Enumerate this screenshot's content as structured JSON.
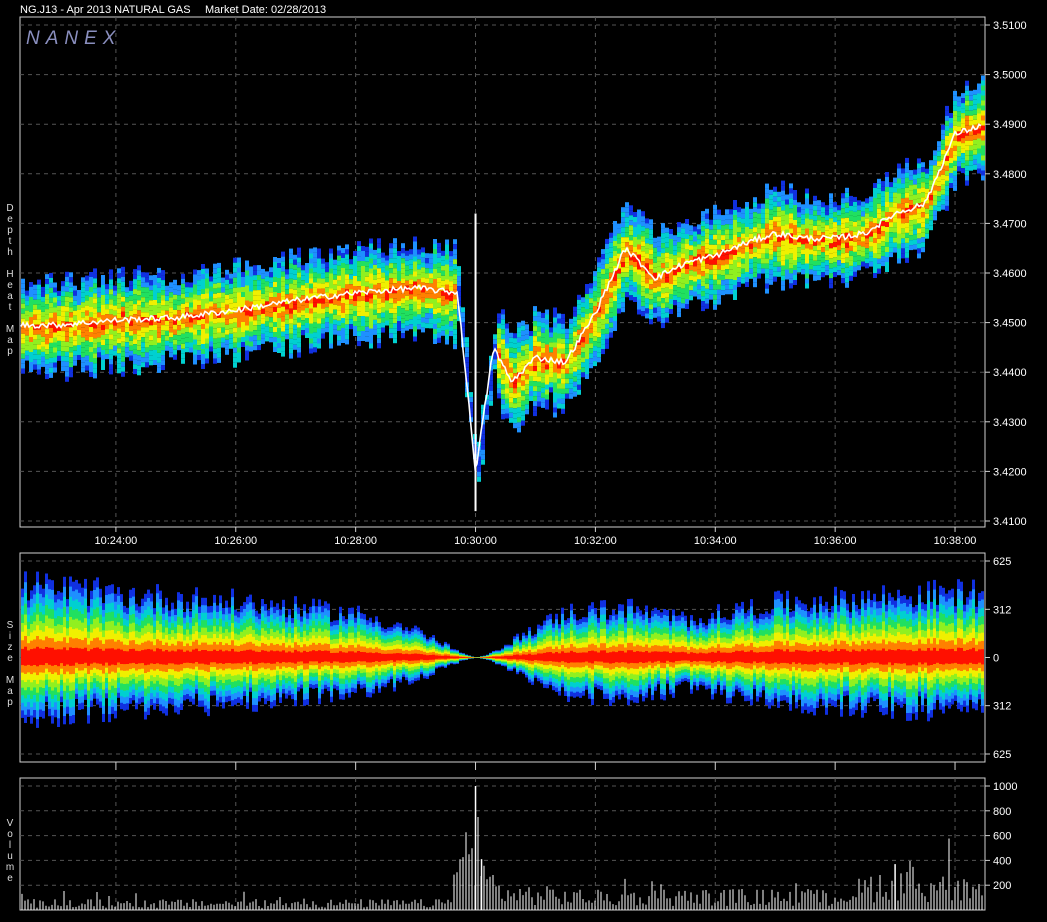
{
  "header": {
    "symbol": "NG.J13 - Apr 2013 NATURAL GAS",
    "market_date": "Market Date: 02/28/2013",
    "logo": "NANEX"
  },
  "panels": {
    "depth": {
      "label": "Depth Heat Map"
    },
    "size": {
      "label": "Size Map"
    },
    "volume": {
      "label": "Volume"
    }
  },
  "colors": {
    "background": "#000000",
    "frame": "#d0d0d0",
    "grid": "#555555",
    "heat_scale": [
      "#1030e0",
      "#1e90ff",
      "#00d0d0",
      "#20e060",
      "#90f020",
      "#f0f000",
      "#ff8000",
      "#ff1000"
    ],
    "last_trade": "#ffffff"
  },
  "chart_data": [
    {
      "type": "heatmap",
      "title": "Depth Heat Map",
      "x_ticks": [
        "10:24:00",
        "10:26:00",
        "10:28:00",
        "10:30:00",
        "10:32:00",
        "10:34:00",
        "10:36:00",
        "10:38:00"
      ],
      "y_ticks": [
        "3.4100",
        "3.4200",
        "3.4300",
        "3.4400",
        "3.4500",
        "3.4600",
        "3.4700",
        "3.4800",
        "3.4900",
        "3.5000",
        "3.5100"
      ],
      "ylim": [
        3.41,
        3.51
      ],
      "xlim_minutes": [
        22.4,
        38.5
      ],
      "price_path": [
        {
          "t": 22.4,
          "p": 3.4495
        },
        {
          "t": 23.0,
          "p": 3.4495
        },
        {
          "t": 24.0,
          "p": 3.4505
        },
        {
          "t": 25.0,
          "p": 3.451
        },
        {
          "t": 26.0,
          "p": 3.4525
        },
        {
          "t": 27.0,
          "p": 3.4545
        },
        {
          "t": 28.0,
          "p": 3.456
        },
        {
          "t": 29.0,
          "p": 3.457
        },
        {
          "t": 29.7,
          "p": 3.456
        },
        {
          "t": 30.0,
          "p": 3.42
        },
        {
          "t": 30.3,
          "p": 3.445
        },
        {
          "t": 30.6,
          "p": 3.438
        },
        {
          "t": 31.0,
          "p": 3.443
        },
        {
          "t": 31.5,
          "p": 3.442
        },
        {
          "t": 32.0,
          "p": 3.452
        },
        {
          "t": 32.5,
          "p": 3.465
        },
        {
          "t": 33.0,
          "p": 3.459
        },
        {
          "t": 33.5,
          "p": 3.462
        },
        {
          "t": 34.0,
          "p": 3.4635
        },
        {
          "t": 34.5,
          "p": 3.466
        },
        {
          "t": 35.0,
          "p": 3.468
        },
        {
          "t": 35.5,
          "p": 3.467
        },
        {
          "t": 36.0,
          "p": 3.467
        },
        {
          "t": 36.5,
          "p": 3.468
        },
        {
          "t": 37.0,
          "p": 3.472
        },
        {
          "t": 37.5,
          "p": 3.474
        },
        {
          "t": 38.0,
          "p": 3.488
        },
        {
          "t": 38.5,
          "p": 3.49
        }
      ]
    },
    {
      "type": "heatmap",
      "title": "Size Map",
      "y_ticks": [
        "625",
        "312",
        "0",
        "312",
        "625"
      ],
      "ylim": [
        -625,
        625
      ],
      "depth_envelope": [
        {
          "t": 22.4,
          "v": 480
        },
        {
          "t": 24.0,
          "v": 420
        },
        {
          "t": 26.0,
          "v": 370
        },
        {
          "t": 28.0,
          "v": 290
        },
        {
          "t": 29.0,
          "v": 180
        },
        {
          "t": 29.8,
          "v": 20
        },
        {
          "t": 30.0,
          "v": 0
        },
        {
          "t": 30.2,
          "v": 20
        },
        {
          "t": 30.8,
          "v": 160
        },
        {
          "t": 31.5,
          "v": 300
        },
        {
          "t": 32.5,
          "v": 330
        },
        {
          "t": 33.5,
          "v": 250
        },
        {
          "t": 35.0,
          "v": 360
        },
        {
          "t": 37.0,
          "v": 410
        },
        {
          "t": 38.5,
          "v": 440
        }
      ]
    },
    {
      "type": "bar",
      "title": "Volume",
      "y_ticks": [
        "200",
        "400",
        "600",
        "800",
        "1000"
      ],
      "ylim": [
        0,
        1000
      ],
      "volume_profile": [
        {
          "t": 22.4,
          "v": 80
        },
        {
          "t": 25.0,
          "v": 80
        },
        {
          "t": 29.5,
          "v": 80
        },
        {
          "t": 30.0,
          "v": 1000
        },
        {
          "t": 30.1,
          "v": 410
        },
        {
          "t": 30.5,
          "v": 200
        },
        {
          "t": 32.0,
          "v": 150
        },
        {
          "t": 34.0,
          "v": 160
        },
        {
          "t": 36.0,
          "v": 150
        },
        {
          "t": 37.0,
          "v": 370
        },
        {
          "t": 38.5,
          "v": 190
        }
      ]
    }
  ]
}
